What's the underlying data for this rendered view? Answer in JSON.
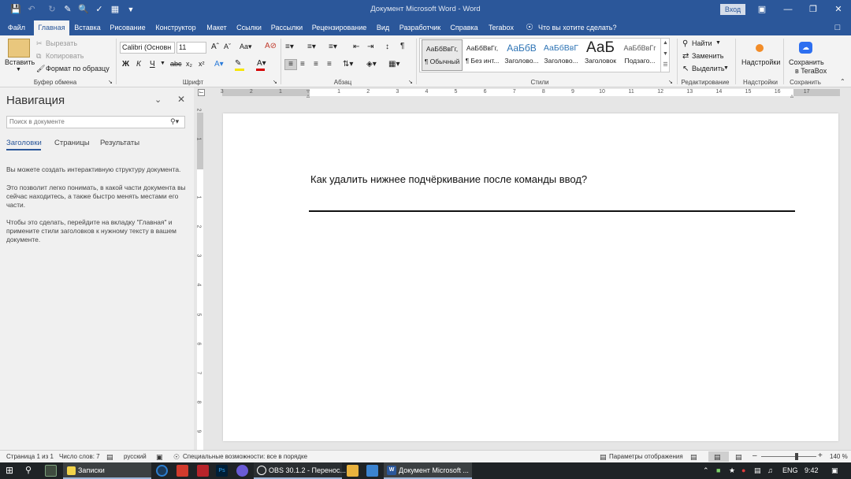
{
  "window": {
    "title": "Документ Microsoft Word  -  Word",
    "signin": "Вход"
  },
  "tabs": [
    "Файл",
    "Главная",
    "Вставка",
    "Рисование",
    "Конструктор",
    "Макет",
    "Ссылки",
    "Рассылки",
    "Рецензирование",
    "Вид",
    "Разработчик",
    "Справка",
    "Terabox"
  ],
  "tell_me": "Что вы хотите сделать?",
  "ribbon": {
    "clipboard": {
      "paste": "Вставить",
      "cut": "Вырезать",
      "copy": "Копировать",
      "format_painter": "Формат по образцу",
      "label": "Буфер обмена"
    },
    "font": {
      "name": "Calibri (Основн",
      "size": "11",
      "label": "Шрифт",
      "bold": "Ж",
      "italic": "К",
      "underline": "Ч"
    },
    "paragraph": {
      "label": "Абзац"
    },
    "styles": {
      "label": "Стили",
      "items": [
        {
          "preview": "АаБбВвГг,",
          "name": "¶ Обычный"
        },
        {
          "preview": "АаБбВвГг,",
          "name": "¶ Без инт..."
        },
        {
          "preview": "АаБбВ",
          "name": "Заголово..."
        },
        {
          "preview": "АаБбВвГ",
          "name": "Заголово..."
        },
        {
          "preview": "АаБ",
          "name": "Заголовок"
        },
        {
          "preview": "АаБбВвГг",
          "name": "Подзаго..."
        }
      ]
    },
    "editing": {
      "find": "Найти",
      "replace": "Заменить",
      "select": "Выделить",
      "label": "Редактирование"
    },
    "addins": {
      "button": "Надстройки",
      "label": "Надстройки"
    },
    "save": {
      "line1": "Сохранить",
      "line2": "в TeraBox",
      "label": "Сохранить"
    }
  },
  "nav_pane": {
    "title": "Навигация",
    "search_placeholder": "Поиск в документе",
    "tabs": [
      "Заголовки",
      "Страницы",
      "Результаты"
    ],
    "text1": "Вы можете создать интерактивную структуру документа.",
    "text2": "Это позволит легко понимать, в какой части документа вы сейчас находитесь, а также быстро менять местами его части.",
    "text3": "Чтобы это сделать, перейдите на вкладку \"Главная\" и примените стили заголовков к нужному тексту в вашем документе."
  },
  "ruler": {
    "top_ticks": [
      "3",
      "2",
      "1",
      "1",
      "2",
      "3",
      "4",
      "5",
      "6",
      "7",
      "8",
      "9",
      "10",
      "11",
      "12",
      "13",
      "14",
      "15",
      "16",
      "17"
    ],
    "left_ticks": [
      "2",
      "1",
      "1",
      "2",
      "3",
      "4",
      "5",
      "6",
      "7",
      "8",
      "9"
    ]
  },
  "document": {
    "text": "Как удалить нижнее подчёркивание после команды ввод?"
  },
  "status": {
    "page": "Страница 1 из 1",
    "words": "Число слов: 7",
    "language": "русский",
    "accessibility": "Специальные возможности: все в порядке",
    "display_settings": "Параметры отображения",
    "zoom": "140 %",
    "zoom_level": 0.64
  },
  "taskbar": {
    "notes": "Записки",
    "obs": "OBS 30.1.2 - Перенос...",
    "word": "Документ Microsoft ...",
    "lang": "ENG",
    "time": "9:42"
  }
}
